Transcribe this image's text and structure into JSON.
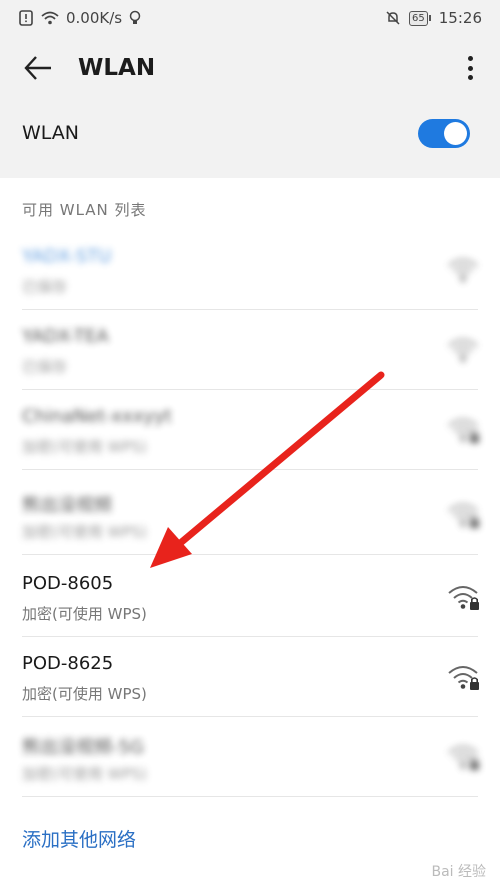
{
  "status": {
    "speed": "0.00K/s",
    "battery": "65",
    "time": "15:26"
  },
  "appbar": {
    "title": "WLAN"
  },
  "toggle": {
    "label": "WLAN",
    "state": "on"
  },
  "list": {
    "header": "可用 WLAN 列表",
    "networks": [
      {
        "name": "YADX-STU",
        "sub": "已保存",
        "blurred": true,
        "locked": false
      },
      {
        "name": "YADX-TEA",
        "sub": "已保存",
        "blurred": true,
        "locked": false
      },
      {
        "name": "ChinaNet-xxxyyt",
        "sub": "加密(可使用 WPS)",
        "blurred": true,
        "locked": true
      },
      {
        "name": "熊出没视频",
        "sub": "加密(可使用 WPS)",
        "blurred": true,
        "locked": true
      },
      {
        "name": "POD-8605",
        "sub": "加密(可使用 WPS)",
        "blurred": false,
        "locked": true
      },
      {
        "name": "POD-8625",
        "sub": "加密(可使用 WPS)",
        "blurred": false,
        "locked": true
      },
      {
        "name": "熊出没视频-5G",
        "sub": "加密(可使用 WPS)",
        "blurred": true,
        "locked": true
      }
    ]
  },
  "add_network": "添加其他网络",
  "annotation": {
    "type": "red-arrow",
    "color": "#e8231c",
    "points_to": "POD-8605"
  },
  "colors": {
    "accent": "#1f7ae0",
    "link": "#2a6fc4",
    "arrow": "#e8231c"
  },
  "watermark": "Bai 经验"
}
